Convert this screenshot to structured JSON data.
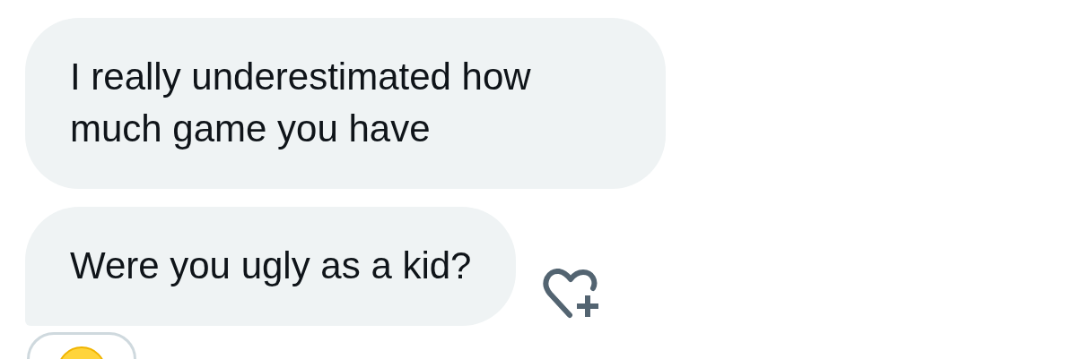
{
  "messages": [
    {
      "text": "I really underestimated how much game you have",
      "tail": false
    },
    {
      "text": "Were you ugly as a kid?",
      "tail": true
    }
  ],
  "reactions": [
    {
      "kind": "emoji"
    }
  ]
}
